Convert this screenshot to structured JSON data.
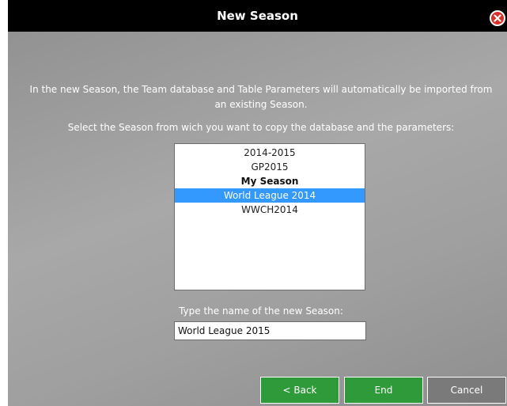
{
  "window": {
    "title": "New Season"
  },
  "intro": {
    "line1": "In the new Season, the Team database and Table Parameters will automatically be imported from",
    "line2": "an existing Season."
  },
  "select_prompt": "Select the Season from wich you want to copy the database and the parameters:",
  "seasons": {
    "items": [
      {
        "label": "2014-2015",
        "bold": false,
        "selected": false
      },
      {
        "label": "GP2015",
        "bold": false,
        "selected": false
      },
      {
        "label": "My Season",
        "bold": true,
        "selected": false
      },
      {
        "label": "World League 2014",
        "bold": false,
        "selected": true
      },
      {
        "label": "WWCH2014",
        "bold": false,
        "selected": false
      }
    ]
  },
  "new_name": {
    "label": "Type the name of the new Season:",
    "value": "World League 2015"
  },
  "buttons": {
    "back": "< Back",
    "end": "End",
    "cancel": "Cancel"
  },
  "colors": {
    "titlebar": "#000000",
    "selection": "#3399ff",
    "primary_button": "#2f9a3a",
    "cancel_button": "#7a7a7a",
    "close_icon": "#d9302a"
  },
  "icons": {
    "close": "close-icon"
  }
}
